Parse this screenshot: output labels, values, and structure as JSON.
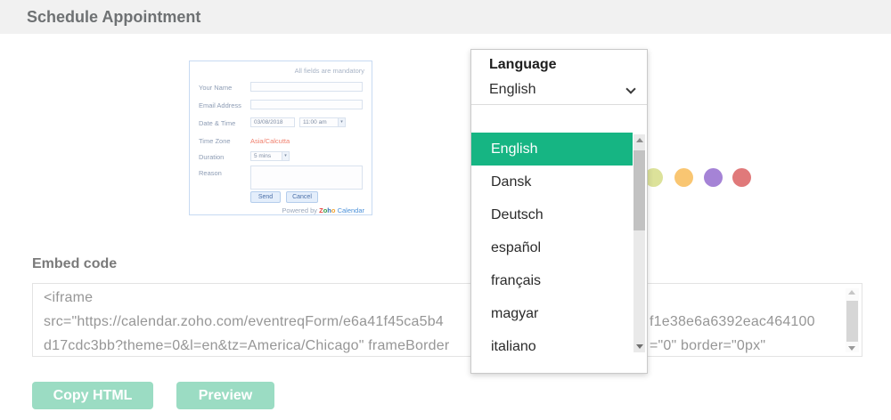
{
  "header": {
    "title": "Schedule Appointment"
  },
  "preview_form": {
    "mandatory_note": "All fields are mandatory",
    "name_label": "Your Name",
    "email_label": "Email Address",
    "datetime_label": "Date & Time",
    "date_value": "03/08/2018",
    "time_value": "11:00 am",
    "timezone_label": "Time Zone",
    "timezone_value": "Asia/Calcutta",
    "timezone_color": "#f0806e",
    "duration_label": "Duration",
    "duration_value": "5 mins",
    "reason_label": "Reason",
    "send_label": "Send",
    "cancel_label": "Cancel",
    "powered_by": "Powered by",
    "brand_letters": [
      {
        "ch": "Z",
        "color": "#e4423c"
      },
      {
        "ch": "o",
        "color": "#3a9e46"
      },
      {
        "ch": "h",
        "color": "#2f6fb5"
      },
      {
        "ch": "o",
        "color": "#f0a32f"
      }
    ],
    "brand_suffix": "Calendar",
    "brand_suffix_color": "#4a90d9"
  },
  "language_dropdown": {
    "label": "Language",
    "selected": "English",
    "highlight_color": "#16b583",
    "options": [
      "English",
      "Dansk",
      "Deutsch",
      "español",
      "français",
      "magyar",
      "italiano"
    ]
  },
  "theme_dots": [
    {
      "name": "yellow-green",
      "color": "#dce29a"
    },
    {
      "name": "orange",
      "color": "#f9c672"
    },
    {
      "name": "purple",
      "color": "#a583d6"
    },
    {
      "name": "red",
      "color": "#e0797a"
    }
  ],
  "embed": {
    "label": "Embed code",
    "line1": "<iframe",
    "line2_left": "src=\"https://calendar.zoho.com/eventreqForm/e6a41f45ca5b4",
    "line2_right": "f1e38e6a6392eac464100",
    "line3_left": "d17cdc3bb?theme=0&l=en&tz=America/Chicago\" frameBorder",
    "line3_right": "=\"0\" border=\"0px\""
  },
  "actions": {
    "copy_html_label": "Copy HTML",
    "preview_label": "Preview",
    "button_color": "#9bdcc3"
  }
}
